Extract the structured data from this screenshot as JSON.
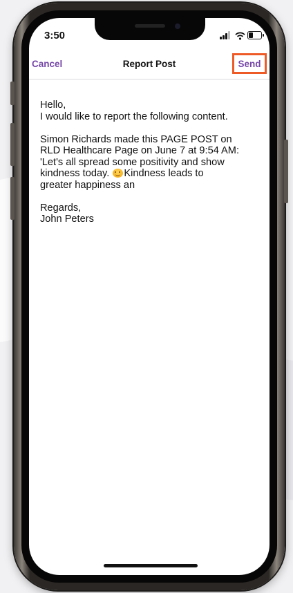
{
  "status_bar": {
    "time": "3:50"
  },
  "nav": {
    "cancel_label": "Cancel",
    "title": "Report Post",
    "send_label": "Send"
  },
  "message": {
    "greeting": "Hello,",
    "intro": "I would like to report the following content.",
    "quote_line1": "Simon Richards made this PAGE POST on",
    "quote_line2": "RLD Healthcare Page on June 7 at 9:54 AM:",
    "quote_line3": "'Let's all spread some positivity and show",
    "quote_line4a": "kindness today. ",
    "quote_line4b": "Kindness leads to",
    "quote_line5": "greater happiness an",
    "closing": "Regards,",
    "signature": "John Peters"
  },
  "colors": {
    "accent": "#7648a8",
    "highlight_border": "#ee5a26"
  }
}
